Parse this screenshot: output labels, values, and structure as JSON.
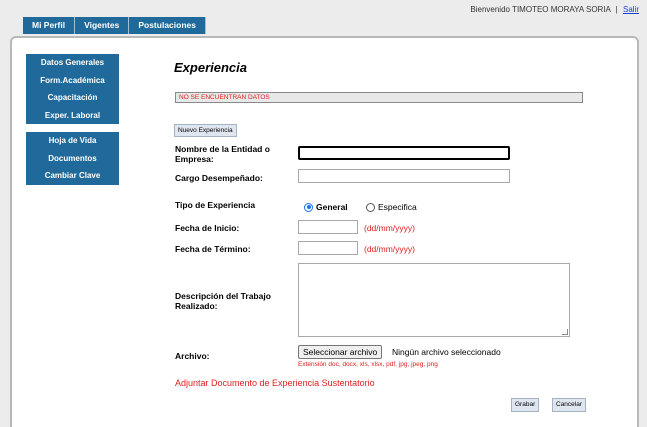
{
  "header": {
    "welcome": "Bienvenido TIMOTEO MORAYA SORIA",
    "separator": "|",
    "logout": "Salir"
  },
  "menu": [
    "Mi Perfil",
    "Vigentes",
    "Postulaciones"
  ],
  "sidebar": {
    "group1": [
      "Datos Generales",
      "Form.Académica",
      "Capacitación",
      "Exper. Laboral"
    ],
    "group2": [
      "Hoja de Vida",
      "Documentos",
      "Cambiar Clave"
    ]
  },
  "page": {
    "title": "Experiencia",
    "alert": "NO SE ENCUENTRAN DATOS",
    "new_button": "Nuevo Experiencia"
  },
  "form": {
    "entidad_label": "Nombre de la Entidad o Empresa:",
    "entidad_value": "",
    "cargo_label": "Cargo Desempeñado:",
    "cargo_value": "",
    "tipo_label": "Tipo de Experiencia",
    "tipo_options": [
      "General",
      "Especifica"
    ],
    "tipo_selected": "General",
    "inicio_label": "Fecha de Inicio:",
    "inicio_value": "",
    "fecha_hint": "(dd/mm/yyyy)",
    "termino_label": "Fecha de Término:",
    "termino_value": "",
    "descripcion_label": "Descripción del Trabajo Realizado:",
    "descripcion_value": "",
    "archivo_label": "Archivo:",
    "archivo_button": "Seleccionar archivo",
    "archivo_status": "Ningún archivo seleccionado",
    "extensiones": "Extensión doc, docx, xls, xlsx, pdf, jpg, jpeg, png",
    "adjuntar": "Adjuntar Documento de Experiencia Sustentatorio",
    "grabar": "Grabar",
    "cancelar": "Cancelar"
  },
  "colors": {
    "menu_bg": "#1f6a9a",
    "error": "#e02020",
    "link": "#1a3fd8"
  }
}
